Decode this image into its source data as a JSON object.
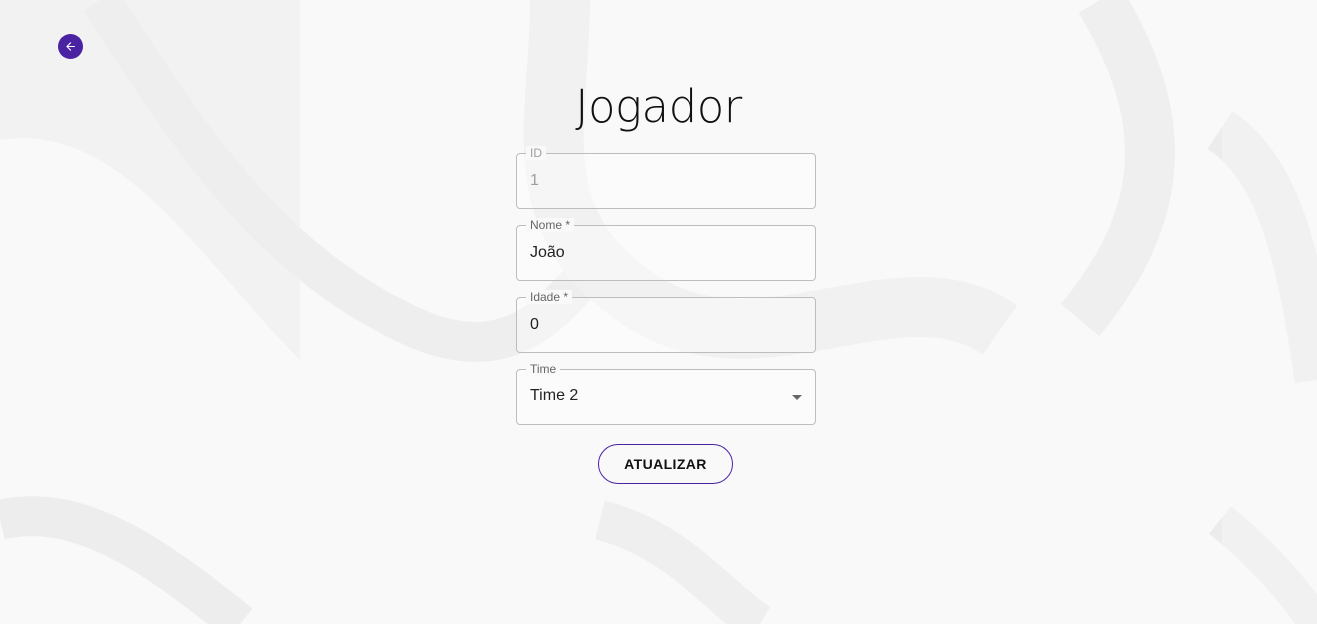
{
  "page": {
    "title": "Jogador"
  },
  "back_button": {
    "icon": "arrow-left-icon"
  },
  "form": {
    "id": {
      "label": "ID",
      "value": "1",
      "disabled": true
    },
    "nome": {
      "label": "Nome *",
      "value": "João"
    },
    "idade": {
      "label": "Idade *",
      "value": "0"
    },
    "time": {
      "label": "Time",
      "selected": "Time 2"
    },
    "submit_label": "ATUALIZAR"
  },
  "colors": {
    "accent": "#4a23a3",
    "background": "#f7f7f8"
  }
}
